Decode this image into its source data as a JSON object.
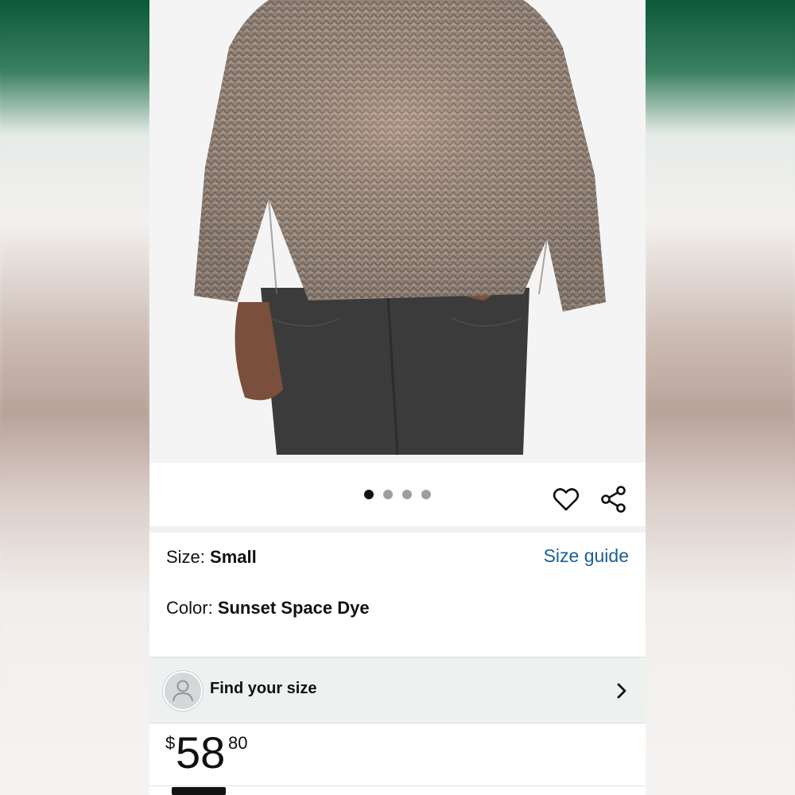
{
  "product": {
    "image_alt": "Sunset Space Dye sweater with dark jeans",
    "gallery": {
      "dot_count": 4,
      "active_index": 0
    }
  },
  "actions": {
    "favorite_icon": "heart-icon",
    "share_icon": "share-icon"
  },
  "options": {
    "size_label": "Size:",
    "size_value": "Small",
    "size_guide_link": "Size guide",
    "color_label": "Color:",
    "color_value": "Sunset Space Dye"
  },
  "find_size": {
    "label": "Find your size",
    "icon": "user-avatar-icon",
    "chevron_icon": "chevron-right-icon"
  },
  "price": {
    "currency": "$",
    "whole": "58",
    "cents": "80"
  },
  "colors": {
    "link": "#1b5f97",
    "text": "#111111",
    "band": "#eff1f1"
  }
}
